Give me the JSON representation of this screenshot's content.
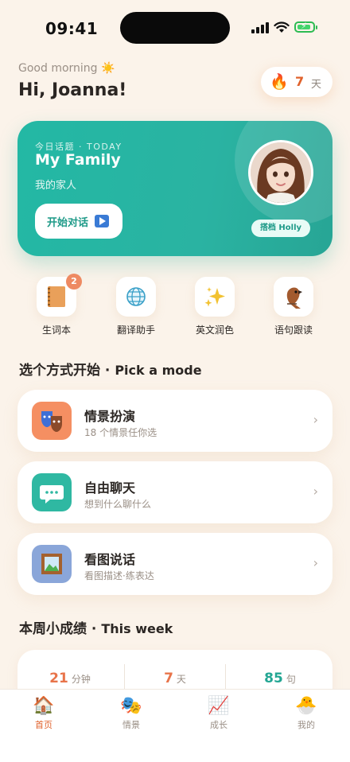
{
  "status": {
    "time": "09:41"
  },
  "header": {
    "greeting": "Good morning ☀️",
    "name": "Hi, Joanna!",
    "streak_value": "7",
    "streak_unit": "天"
  },
  "hero": {
    "kicker": "今日话题 · TODAY",
    "title": "My Family",
    "subtitle": "我的家人",
    "button_label": "开始对话",
    "partner_label": "搭档 Holly"
  },
  "tools": [
    {
      "label": "生词本",
      "badge": "2",
      "icon": "notebook-icon"
    },
    {
      "label": "翻译助手",
      "icon": "globe-icon"
    },
    {
      "label": "英文润色",
      "icon": "sparkles-icon"
    },
    {
      "label": "语句跟读",
      "icon": "parrot-icon"
    }
  ],
  "modes_section": {
    "title": "选个方式开始",
    "title_en": "Pick a mode"
  },
  "modes": [
    {
      "title": "情景扮演",
      "subtitle": "18 个情景任你选",
      "icon": "theater-masks-icon",
      "color": "#f58f62"
    },
    {
      "title": "自由聊天",
      "subtitle": "想到什么聊什么",
      "icon": "chat-bubble-icon",
      "color": "#2fb8a2"
    },
    {
      "title": "看图说话",
      "subtitle": "看图描述·练表达",
      "icon": "framed-picture-icon",
      "color": "#8aa6d9"
    }
  ],
  "week_section": {
    "title": "本周小成绩",
    "title_en": "This week"
  },
  "stats": [
    {
      "value": "21",
      "unit": "分钟",
      "color": "#e8744a"
    },
    {
      "value": "7",
      "unit": "天",
      "color": "#e8744a"
    },
    {
      "value": "85",
      "unit": "句",
      "color": "#23a693"
    }
  ],
  "tabs": [
    {
      "label": "首页",
      "icon": "house-icon",
      "active": true
    },
    {
      "label": "情景",
      "icon": "masks-icon"
    },
    {
      "label": "成长",
      "icon": "chart-icon"
    },
    {
      "label": "我的",
      "icon": "chick-icon"
    }
  ]
}
